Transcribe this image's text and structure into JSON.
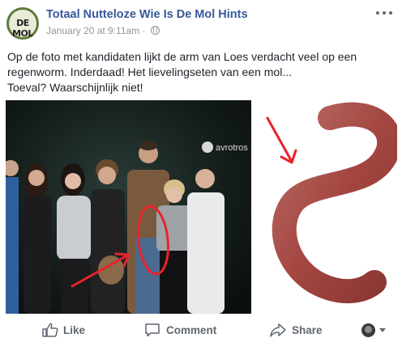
{
  "post": {
    "page_name": "Totaal Nutteloze Wie Is De Mol Hints",
    "avatar_text": "DE MOL",
    "timestamp": "January 20 at 9:11am",
    "separator": " · ",
    "audience_icon": "globe-icon",
    "more_icon": "more-options-icon",
    "text_lines": [
      "Op de foto met kandidaten lijkt de arm van Loes verdacht veel op een",
      "regenworm. Inderdaad! Het lievelingseten van een mol...",
      "Toeval? Waarschijnlijk niet!"
    ]
  },
  "image": {
    "watermark": "avrotros",
    "annotation_color": "#e8232a"
  },
  "actions": {
    "like": "Like",
    "comment": "Comment",
    "share": "Share"
  },
  "colors": {
    "link": "#365899",
    "meta": "#90949c",
    "action": "#606770"
  }
}
